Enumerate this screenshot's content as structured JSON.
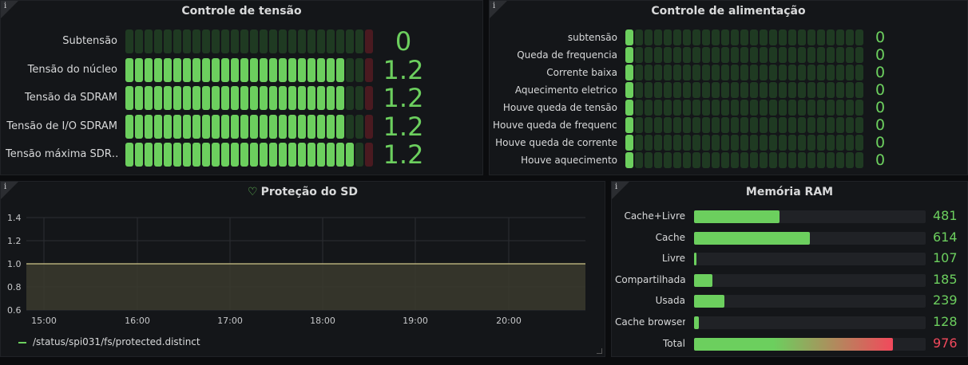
{
  "panels": {
    "tensao": {
      "title": "Controle de tensão",
      "info": "i",
      "cells": 25,
      "max": 1.3,
      "rows": [
        {
          "label": "Subtensão",
          "value": "0",
          "fraction": 0.0
        },
        {
          "label": "Tensão do núcleo",
          "value": "1.2",
          "fraction": 0.923
        },
        {
          "label": "Tensão da SDRAM",
          "value": "1.2",
          "fraction": 0.923
        },
        {
          "label": "Tensão de I/O SDRAM",
          "value": "1.2",
          "fraction": 0.923
        },
        {
          "label": "Tensão máxima SDR…",
          "value": "1.2",
          "fraction": 0.96
        }
      ]
    },
    "alimentacao": {
      "title": "Controle de alimentação",
      "info": "i",
      "cells": 25,
      "rows": [
        {
          "label": "subtensão",
          "value": "0"
        },
        {
          "label": "Queda de frequencia",
          "value": "0"
        },
        {
          "label": "Corrente baixa",
          "value": "0"
        },
        {
          "label": "Aquecimento eletrico",
          "value": "0"
        },
        {
          "label": "Houve queda de tensão",
          "value": "0"
        },
        {
          "label": "Houve queda de frequencia",
          "value": "0"
        },
        {
          "label": "Houve queda de corrente",
          "value": "0"
        },
        {
          "label": "Houve aquecimento",
          "value": "0"
        }
      ]
    },
    "sd": {
      "title": "Proteção do SD",
      "info": "i",
      "heart_icon": "heart-icon",
      "chart_data": {
        "type": "area",
        "x": [
          "15:00",
          "16:00",
          "17:00",
          "18:00",
          "19:00",
          "20:00"
        ],
        "y_ticks": [
          "1.4",
          "1.2",
          "1.0",
          "0.8",
          "0.6"
        ],
        "ylim": [
          0.6,
          1.4
        ],
        "series": [
          {
            "name": "/status/spi031/fs/protected.distinct",
            "values": [
              1,
              1,
              1,
              1,
              1,
              1
            ]
          }
        ],
        "legend": "bottom-left",
        "grid": true
      }
    },
    "ram": {
      "title": "Memória RAM",
      "info": "i",
      "max": 1024,
      "rows": [
        {
          "label": "Cache+Livre",
          "value": "481",
          "fraction": 0.37
        },
        {
          "label": "Cache",
          "value": "614",
          "fraction": 0.5
        },
        {
          "label": "Livre",
          "value": "107",
          "fraction": 0.01
        },
        {
          "label": "Compartilhada",
          "value": "185",
          "fraction": 0.08
        },
        {
          "label": "Usada",
          "value": "239",
          "fraction": 0.13
        },
        {
          "label": "Cache browser",
          "value": "128",
          "fraction": 0.02
        },
        {
          "label": "Total",
          "value": "976",
          "fraction": 0.86,
          "color": "#f2495c"
        }
      ]
    }
  },
  "colors": {
    "green": "#6ccf5e",
    "green_dim": "#1f3a22",
    "red": "#f2495c",
    "red_dim": "#4a1a20"
  }
}
